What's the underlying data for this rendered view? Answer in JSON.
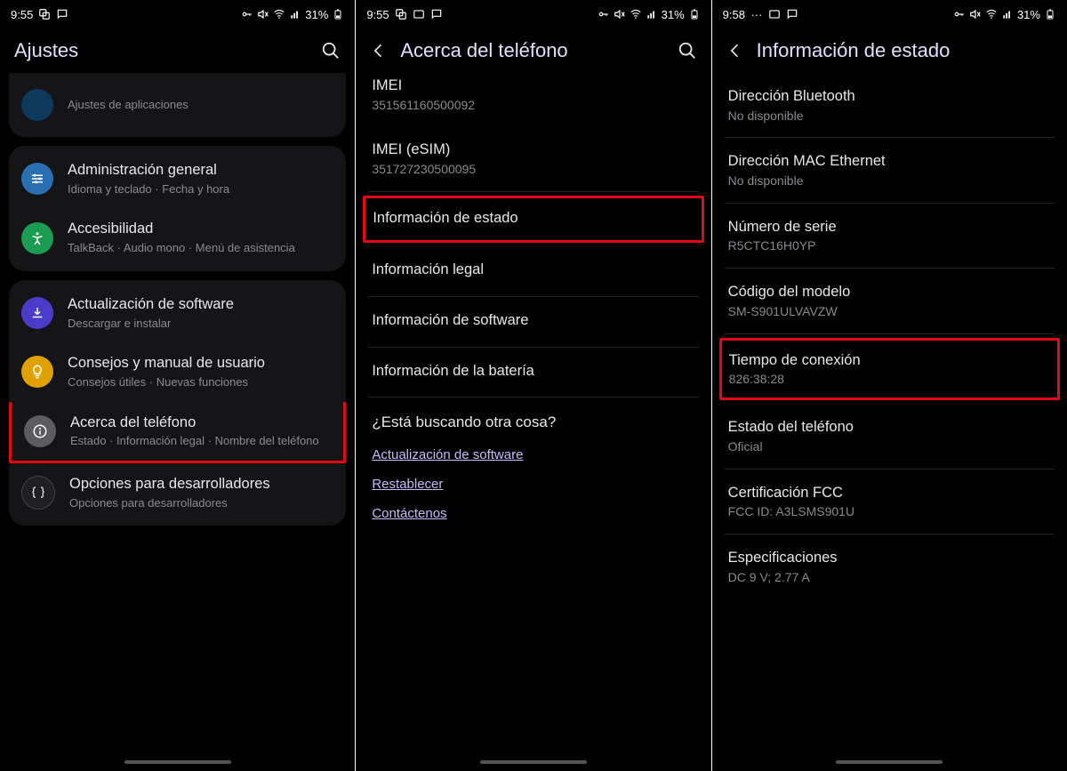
{
  "screens": {
    "s1": {
      "status": {
        "time": "9:55",
        "battery": "31%"
      },
      "title": "Ajustes",
      "top_cutoff": {
        "sub": "Ajustes de aplicaciones"
      },
      "items": [
        {
          "icon": "sliders",
          "bg": "#2b6fb3",
          "title": "Administración general",
          "sub": "Idioma y teclado  ·  Fecha y hora"
        },
        {
          "icon": "accessibility",
          "bg": "#1a9c52",
          "title": "Accesibilidad",
          "sub": "TalkBack  ·  Audio mono  ·  Menú de asistencia"
        },
        {
          "icon": "update",
          "bg": "#4a3cc9",
          "title": "Actualización de software",
          "sub": "Descargar e instalar"
        },
        {
          "icon": "bulb",
          "bg": "#e0a200",
          "title": "Consejos y manual de usuario",
          "sub": "Consejos útiles  ·  Nuevas funciones"
        },
        {
          "icon": "info",
          "bg": "#5b5b60",
          "title": "Acerca del teléfono",
          "sub": "Estado  ·  Información legal  ·  Nombre del teléfono",
          "highlight": true
        },
        {
          "icon": "braces",
          "bg": "#202024",
          "title": "Opciones para desarrolladores",
          "sub": "Opciones para desarrolladores"
        }
      ]
    },
    "s2": {
      "status": {
        "time": "9:55",
        "battery": "31%"
      },
      "title": "Acerca del teléfono",
      "top_items": [
        {
          "title": "IMEI",
          "sub": "351561160500092"
        },
        {
          "title": "IMEI (eSIM)",
          "sub": "351727230500095"
        }
      ],
      "menu": [
        {
          "label": "Información de estado",
          "highlight": true
        },
        {
          "label": "Información legal"
        },
        {
          "label": "Información de software"
        },
        {
          "label": "Información de la batería"
        }
      ],
      "question": "¿Está buscando otra cosa?",
      "links": [
        "Actualización de software",
        "Restablecer",
        "Contáctenos"
      ]
    },
    "s3": {
      "status": {
        "time": "9:58",
        "battery": "31%"
      },
      "title": "Información de estado",
      "rows": [
        {
          "title": "Dirección Bluetooth",
          "sub": "No disponible"
        },
        {
          "title": "Dirección MAC Ethernet",
          "sub": "No disponible"
        },
        {
          "title": "Número de serie",
          "sub": "R5CTC16H0YP"
        },
        {
          "title": "Código del modelo",
          "sub": "SM-S901ULVAVZW"
        },
        {
          "title": "Tiempo de conexión",
          "sub": "826:38:28",
          "highlight": true
        },
        {
          "title": "Estado del teléfono",
          "sub": "Oficial"
        },
        {
          "title": "Certificación FCC",
          "sub": "FCC ID: A3LSMS901U"
        },
        {
          "title": "Especificaciones",
          "sub": "DC 9 V; 2.77 A"
        }
      ]
    }
  }
}
